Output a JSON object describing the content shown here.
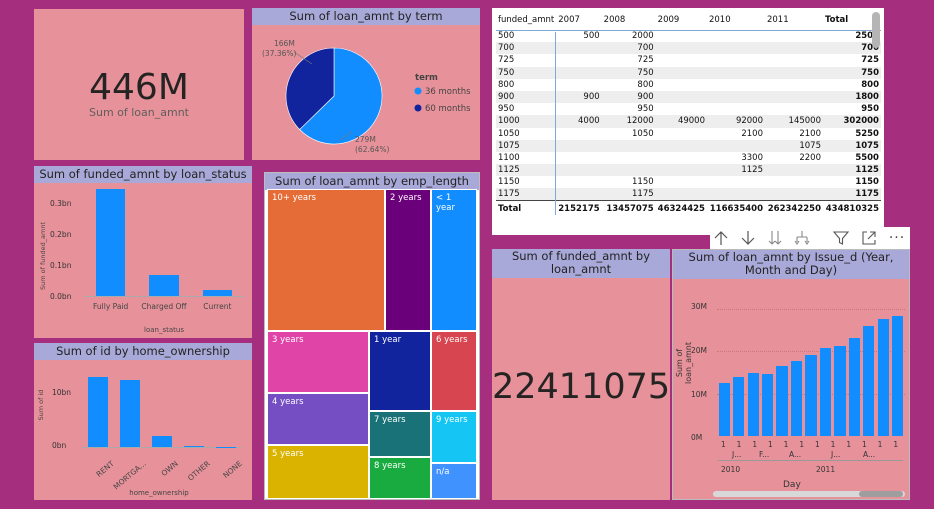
{
  "card1": {
    "value": "446M",
    "label": "Sum of loan_amnt"
  },
  "pie": {
    "title": "Sum of loan_amnt by term",
    "legend_title": "term",
    "slices": [
      {
        "name": "36 months",
        "value": 279,
        "label": "279M",
        "pct": "(62.64%)",
        "color": "#118dff"
      },
      {
        "name": "60 months",
        "value": 166,
        "label": "166M",
        "pct": "(37.36%)",
        "color": "#12239e"
      }
    ]
  },
  "matrix": {
    "headers": [
      "funded_amnt",
      "2007",
      "2008",
      "2009",
      "2010",
      "2011",
      "Total"
    ],
    "rows": [
      [
        "500",
        "500",
        "2000",
        "",
        "",
        "",
        "2500"
      ],
      [
        "700",
        "",
        "700",
        "",
        "",
        "",
        "700"
      ],
      [
        "725",
        "",
        "725",
        "",
        "",
        "",
        "725"
      ],
      [
        "750",
        "",
        "750",
        "",
        "",
        "",
        "750"
      ],
      [
        "800",
        "",
        "800",
        "",
        "",
        "",
        "800"
      ],
      [
        "900",
        "900",
        "900",
        "",
        "",
        "",
        "1800"
      ],
      [
        "950",
        "",
        "950",
        "",
        "",
        "",
        "950"
      ],
      [
        "1000",
        "4000",
        "12000",
        "49000",
        "92000",
        "145000",
        "302000"
      ],
      [
        "1050",
        "",
        "1050",
        "",
        "2100",
        "2100",
        "5250"
      ],
      [
        "1075",
        "",
        "",
        "",
        "",
        "1075",
        "1075"
      ],
      [
        "1100",
        "",
        "",
        "",
        "3300",
        "2200",
        "5500"
      ],
      [
        "1125",
        "",
        "",
        "",
        "1125",
        "",
        "1125"
      ],
      [
        "1150",
        "",
        "1150",
        "",
        "",
        "",
        "1150"
      ],
      [
        "1175",
        "",
        "1175",
        "",
        "",
        "",
        "1175"
      ]
    ],
    "total": [
      "Total",
      "2152175",
      "13457075",
      "46324425",
      "116635400",
      "262342250",
      "434810325"
    ]
  },
  "toolbar": {
    "icons": [
      "arrow-up-icon",
      "arrow-down-icon",
      "double-arrow-down-icon",
      "expand-hierarchy-icon",
      "filter-icon",
      "focus-mode-icon",
      "more-options-icon"
    ],
    "more": "..."
  },
  "status_chart": {
    "title": "Sum of funded_amnt by loan_status",
    "ylabel": "Sum of funded_amnt",
    "xlabel": "loan_status",
    "yticks": [
      "0.3bn",
      "0.2bn",
      "0.1bn",
      "0.0bn"
    ]
  },
  "home_chart": {
    "title": "Sum of id by home_ownership",
    "ylabel": "Sum of id",
    "xlabel": "home_ownership",
    "yticks": [
      "10bn",
      "0bn"
    ]
  },
  "treemap": {
    "title": "Sum of loan_amnt by emp_length",
    "tiles": [
      {
        "label": "10+ years",
        "color": "#e66c37"
      },
      {
        "label": "2 years",
        "color": "#6b007b"
      },
      {
        "label": "< 1 year",
        "color": "#118dff"
      },
      {
        "label": "3 years",
        "color": "#e044a7"
      },
      {
        "label": "1 year",
        "color": "#12239e"
      },
      {
        "label": "6 years",
        "color": "#d64550"
      },
      {
        "label": "4 years",
        "color": "#744ec2"
      },
      {
        "label": "7 years",
        "color": "#197278"
      },
      {
        "label": "9 years",
        "color": "#15c6f4"
      },
      {
        "label": "5 years",
        "color": "#d9b300"
      },
      {
        "label": "8 years",
        "color": "#1aab40"
      },
      {
        "label": "n/a",
        "color": "#4092ff"
      }
    ]
  },
  "card2": {
    "title": "Sum of funded_amnt by loan_amnt",
    "value": "22411075"
  },
  "issue_chart": {
    "title": "Sum of loan_amnt by Issue_d (Year, Month and Day)",
    "ylabel": "Sum of loan_amnt",
    "xlabel": "Day",
    "yticks": [
      "30M",
      "20M",
      "10M",
      "0M"
    ],
    "day_labels": [
      "1",
      "1",
      "1",
      "1",
      "1",
      "1",
      "1",
      "1",
      "1",
      "1",
      "1",
      "1"
    ],
    "month_labels": [
      "J...",
      "F...",
      "A...",
      "J...",
      "A..."
    ],
    "years": [
      "2010",
      "2011"
    ]
  },
  "chart_data": [
    {
      "type": "bar",
      "title": "Sum of funded_amnt by loan_status",
      "categories": [
        "Fully Paid",
        "Charged Off",
        "Current"
      ],
      "values": [
        0.35,
        0.07,
        0.02
      ],
      "ylabel": "Sum of funded_amnt",
      "xlabel": "loan_status",
      "ylim": [
        0,
        0.36
      ]
    },
    {
      "type": "bar",
      "title": "Sum of id by home_ownership",
      "categories": [
        "RENT",
        "MORTGA...",
        "OWN",
        "OTHER",
        "NONE"
      ],
      "values": [
        12.5,
        12,
        1.9,
        0.15,
        0.05
      ],
      "ylabel": "Sum of id",
      "xlabel": "home_ownership",
      "ylim": [
        0,
        15
      ]
    },
    {
      "type": "pie",
      "title": "Sum of loan_amnt by term",
      "categories": [
        "36 months",
        "60 months"
      ],
      "values": [
        279,
        166
      ]
    },
    {
      "type": "bar",
      "title": "Sum of loan_amnt by Issue_d (Year, Month and Day)",
      "categories": [
        "1",
        "2",
        "3",
        "4",
        "5",
        "6",
        "7",
        "8",
        "9",
        "10",
        "11",
        "12"
      ],
      "values": [
        12.5,
        13.8,
        14.8,
        14.6,
        16.5,
        17.6,
        19.0,
        20.7,
        21.2,
        23.0,
        25.8,
        27.6,
        28.2
      ],
      "ylabel": "Sum of loan_amnt",
      "xlabel": "Day",
      "ylim": [
        0,
        32
      ]
    }
  ]
}
